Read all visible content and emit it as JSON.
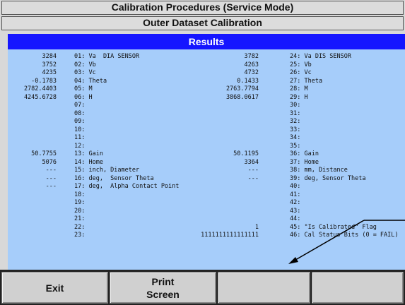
{
  "window_title": "Calibration Procedures (Service Mode)",
  "subtitle": "Outer Dataset Calibration",
  "results_header": "Results",
  "left_rows": [
    {
      "value": "3284",
      "label": "01: Va  DIA SENSOR"
    },
    {
      "value": "3752",
      "label": "02: Vb"
    },
    {
      "value": "4235",
      "label": "03: Vc"
    },
    {
      "value": "-0.1783",
      "label": "04: Theta"
    },
    {
      "value": "2782.4403",
      "label": "05: M"
    },
    {
      "value": "4245.6728",
      "label": "06: H"
    },
    {
      "value": "",
      "label": "07:"
    },
    {
      "value": "",
      "label": "08:"
    },
    {
      "value": "",
      "label": "09:"
    },
    {
      "value": "",
      "label": "10:"
    },
    {
      "value": "",
      "label": "11:"
    },
    {
      "value": "",
      "label": "12:"
    },
    {
      "value": "50.7755",
      "label": "13: Gain"
    },
    {
      "value": "5076",
      "label": "14: Home"
    },
    {
      "value": "---",
      "label": "15: inch, Diameter"
    },
    {
      "value": "---",
      "label": "16: deg,  Sensor Theta"
    },
    {
      "value": "---",
      "label": "17: deg,  Alpha Contact Point"
    },
    {
      "value": "",
      "label": "18:"
    },
    {
      "value": "",
      "label": "19:"
    },
    {
      "value": "",
      "label": "20:"
    },
    {
      "value": "",
      "label": "21:"
    },
    {
      "value": "",
      "label": "22:"
    },
    {
      "value": "",
      "label": "23:"
    }
  ],
  "right_rows": [
    {
      "value": "3782",
      "label": "24: Va DIS SENSOR"
    },
    {
      "value": "4263",
      "label": "25: Vb"
    },
    {
      "value": "4732",
      "label": "26: Vc"
    },
    {
      "value": "0.1433",
      "label": "27: Theta"
    },
    {
      "value": "2763.7794",
      "label": "28: M"
    },
    {
      "value": "3868.0617",
      "label": "29: H"
    },
    {
      "value": "",
      "label": "30:"
    },
    {
      "value": "",
      "label": "31:"
    },
    {
      "value": "",
      "label": "32:"
    },
    {
      "value": "",
      "label": "33:"
    },
    {
      "value": "",
      "label": "34:"
    },
    {
      "value": "",
      "label": "35:"
    },
    {
      "value": "50.1195",
      "label": "36: Gain"
    },
    {
      "value": "3364",
      "label": "37: Home"
    },
    {
      "value": "---",
      "label": "38: mm, Distance"
    },
    {
      "value": "---",
      "label": "39: deg, Sensor Theta"
    },
    {
      "value": "",
      "label": "40:"
    },
    {
      "value": "",
      "label": "41:"
    },
    {
      "value": "",
      "label": "42:"
    },
    {
      "value": "",
      "label": "43:"
    },
    {
      "value": "",
      "label": "44:"
    },
    {
      "value": "1",
      "label": "45: \"Is Calibrated\" Flag"
    },
    {
      "value": "1111111111111111",
      "label": "46: Cal Status Bits (0 = FAIL)"
    }
  ],
  "buttons": {
    "exit": "Exit",
    "print_line1": "Print",
    "print_line2": "Screen",
    "blank1": "",
    "blank2": ""
  },
  "colors": {
    "results_header_bg": "#1515ff",
    "results_bg": "#a6cdfa",
    "button_bar_bg": "#222222"
  },
  "icons": [
    "arrow-pointer-annotation-icon"
  ]
}
